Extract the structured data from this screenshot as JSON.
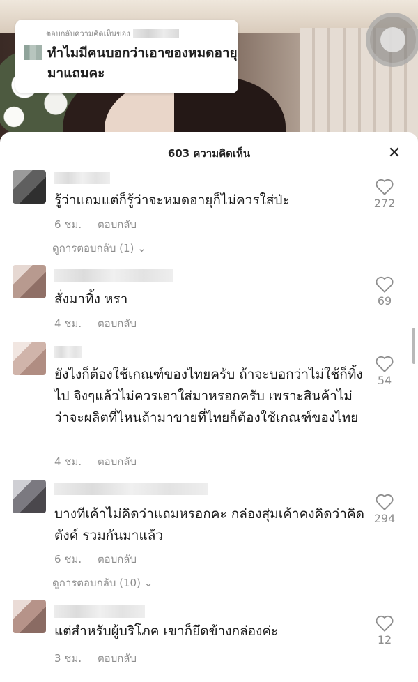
{
  "reply_bubble": {
    "label": "ตอบกลับความคิดเห็นของ",
    "text": "ทำไมมีคนบอกว่าเอาของหมดอายุมาแถมคะ"
  },
  "sheet": {
    "title": "603 ความคิดเห็น",
    "close_icon": "close-icon"
  },
  "comments": [
    {
      "text": "รู้ว่าแถมแต่ก็รู้ว่าจะหมดอายุก็ไม่ควรใส่ป่ะ",
      "time": "6 ชม.",
      "reply_label": "ตอบกลับ",
      "likes": "272",
      "view_replies": "ดูการตอบกลับ (1)"
    },
    {
      "text": "สั่งมาทิ้ง หรา",
      "time": "4 ชม.",
      "reply_label": "ตอบกลับ",
      "likes": "69"
    },
    {
      "text": "ยังไงก็ต้องใช้เกณฑ์ของไทยครับ ถ้าจะบอกว่าไม่ใช้ก็ทิ้งไป จิงๆแล้วไม่ควรเอาใส่มาหรอกครับ เพราะสินค้าไม่ว่าจะผลิตที่ไหนถ้ามาขายที่ไทยก็ต้องใช้เกณฑ์ของไทย",
      "time": "4 ชม.",
      "reply_label": "ตอบกลับ",
      "likes": "54"
    },
    {
      "text": "บางทีเค้าไม่คิดว่าแถมหรอกคะ  กล่องสุ่มเค้าคงคิดว่าคิดตังค์ รวมกันมาแล้ว",
      "time": "6 ชม.",
      "reply_label": "ตอบกลับ",
      "likes": "294",
      "view_replies": "ดูการตอบกลับ (10)"
    },
    {
      "text": "แต่สำหรับผู้บริโภค เขาก็ยึดข้างกล่องค่ะ",
      "time": "3 ชม.",
      "reply_label": "ตอบกลับ",
      "likes": "12"
    }
  ]
}
